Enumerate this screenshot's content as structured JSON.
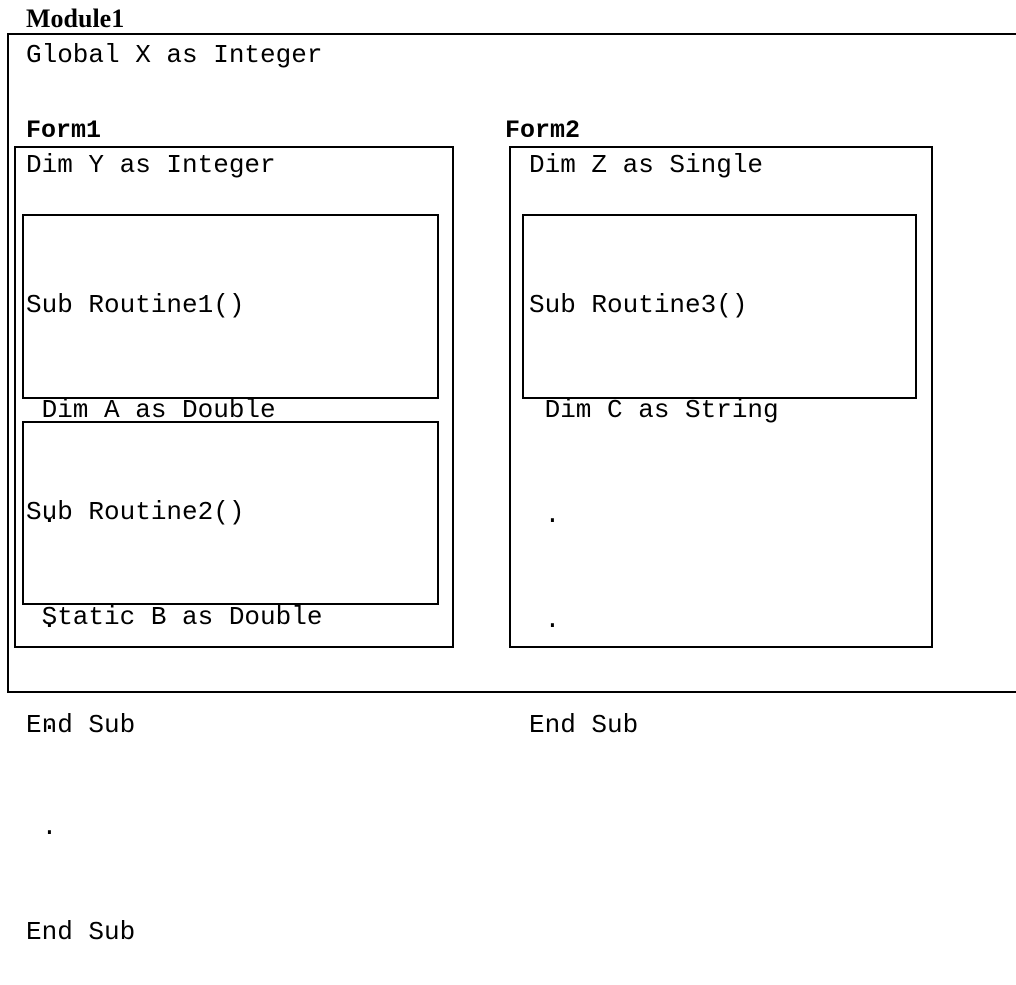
{
  "module": {
    "title": "Module1",
    "declaration": "Global X as Integer"
  },
  "form1": {
    "label": "Form1",
    "declaration": "Dim Y as Integer",
    "routine1": {
      "lines": [
        "Sub Routine1()",
        " Dim A as Double",
        " .",
        " .",
        "End Sub"
      ]
    },
    "routine2": {
      "lines": [
        "Sub Routine2()",
        " Static B as Double",
        " .",
        " .",
        "End Sub"
      ]
    }
  },
  "form2": {
    "label": "Form2",
    "declaration": "Dim Z as Single",
    "routine3": {
      "lines": [
        "Sub Routine3()",
        " Dim C as String",
        " .",
        " .",
        "End Sub"
      ]
    }
  }
}
